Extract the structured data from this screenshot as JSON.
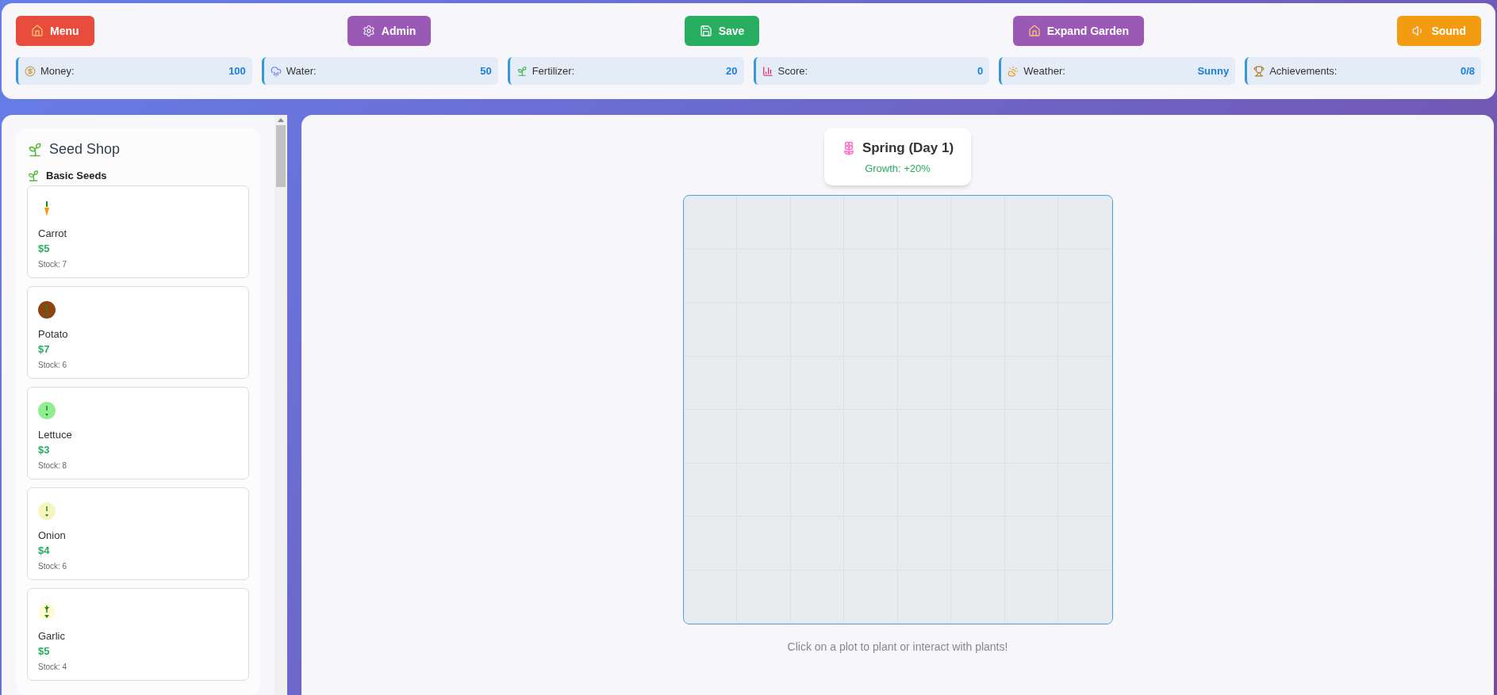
{
  "toolbar": {
    "buttons": [
      {
        "label": "Menu",
        "kind": "house",
        "color": "#e74c3c"
      },
      {
        "label": "Admin",
        "kind": "gear",
        "color": "#9b59b6"
      },
      {
        "label": "Save",
        "kind": "floppy",
        "color": "#27ae60"
      },
      {
        "label": "Expand Garden",
        "kind": "house",
        "color": "#9b59b6"
      },
      {
        "label": "Sound",
        "kind": "speaker",
        "color": "#f39c12"
      }
    ]
  },
  "stats": [
    {
      "label": "Money:",
      "value": "100",
      "kind": "moneybag"
    },
    {
      "label": "Water:",
      "value": "50",
      "kind": "rain"
    },
    {
      "label": "Fertilizer:",
      "value": "20",
      "kind": "sprout"
    },
    {
      "label": "Score:",
      "value": "0",
      "kind": "chart"
    },
    {
      "label": "Weather:",
      "value": "Sunny",
      "kind": "sun-cloud"
    },
    {
      "label": "Achievements:",
      "value": "0/8",
      "kind": "trophy"
    }
  ],
  "seed_shop": {
    "title": "Seed Shop",
    "category": "Basic Seeds",
    "seeds": [
      {
        "name": "Carrot",
        "price": "$5",
        "stock": "Stock: 7",
        "kind": "carrot",
        "color": "#f39c12"
      },
      {
        "name": "Potato",
        "price": "$7",
        "stock": "Stock: 6",
        "kind": "round",
        "color": "#8b4513"
      },
      {
        "name": "Lettuce",
        "price": "$3",
        "stock": "Stock: 8",
        "kind": "round",
        "color": "#90ee90"
      },
      {
        "name": "Onion",
        "price": "$4",
        "stock": "Stock: 6",
        "kind": "round",
        "color": "#f5f5c0"
      },
      {
        "name": "Garlic",
        "price": "$5",
        "stock": "Stock: 4",
        "kind": "stem",
        "color": "#fffacd"
      }
    ]
  },
  "season": {
    "title": "Spring (Day 1)",
    "growth": "Growth: +20%"
  },
  "hint": "Click on a plot to plant or interact with plants!"
}
